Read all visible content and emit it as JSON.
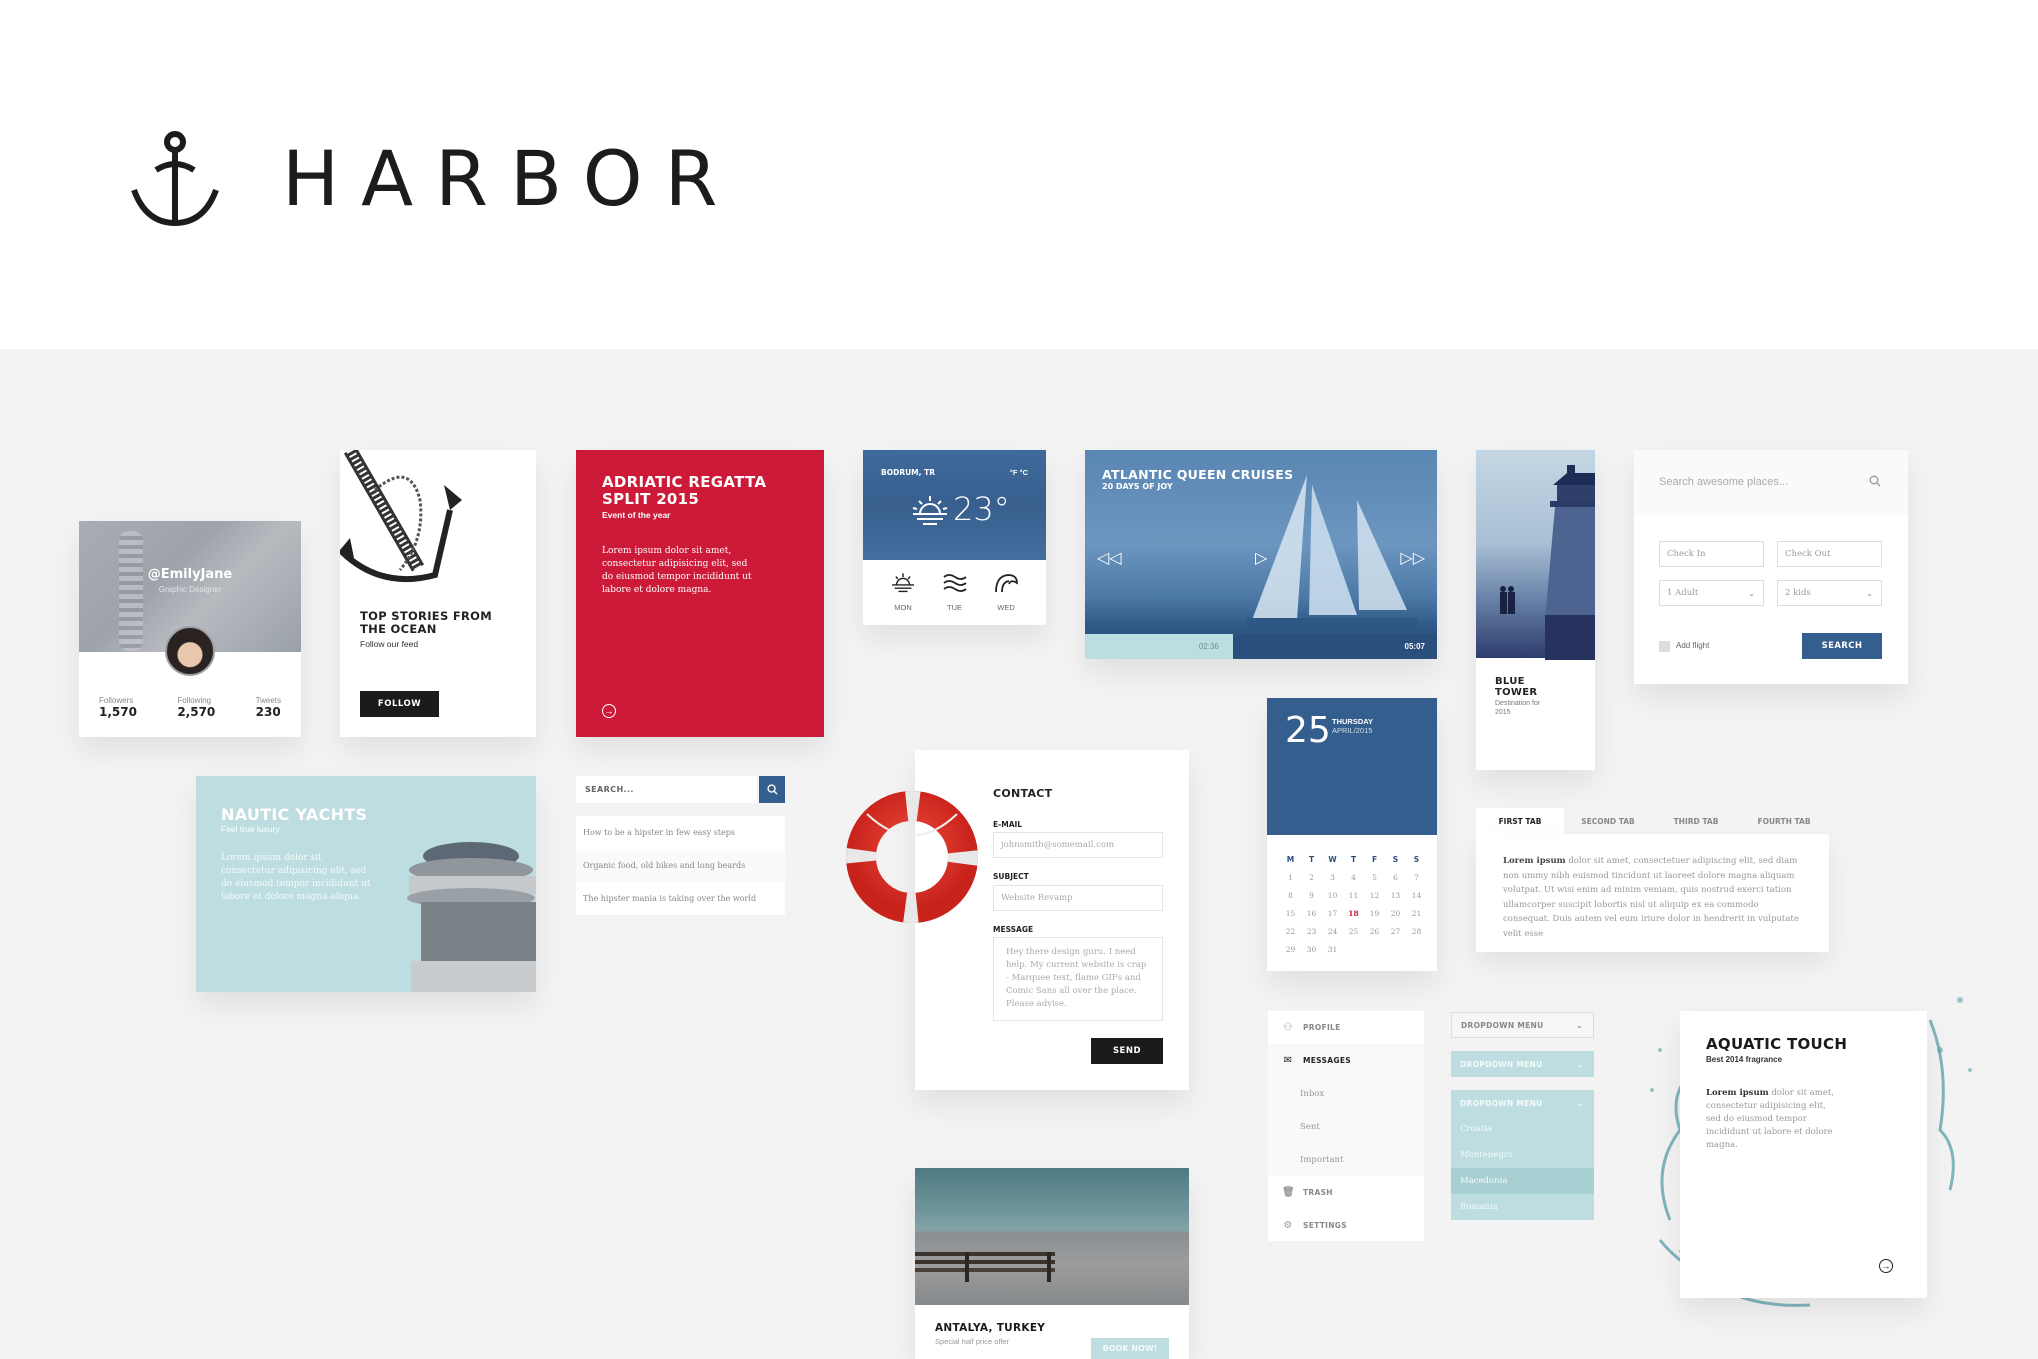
{
  "brand": {
    "name": "HARBOR",
    "logo_icon": "anchor-icon"
  },
  "colors": {
    "accent_blue": "#335e8d",
    "accent_red": "#cc1a38",
    "accent_teal": "#bddde0",
    "background": "#f3f3f3"
  },
  "profile_card": {
    "handle": "@EmilyJane",
    "role": "Graphic Designer",
    "stats": [
      {
        "label": "Followers",
        "value": "1,570"
      },
      {
        "label": "Following",
        "value": "2,570"
      },
      {
        "label": "Tweets",
        "value": "230"
      }
    ]
  },
  "stories_card": {
    "title": "TOP STORIES FROM THE OCEAN",
    "subtitle": "Follow our feed",
    "button": "FOLLOW"
  },
  "regatta_card": {
    "title": "ADRIATIC REGATTA SPLIT 2015",
    "subtitle": "Event of the year",
    "body": "Lorem ipsum dolor sit amet, consectetur adipisicing elit, sed do eiusmod tempor incididunt ut labore et dolore magna.",
    "arrow_icon": "arrow-right-circle-icon"
  },
  "weather_card": {
    "location": "BODRUM, TR",
    "units": "°F °C",
    "temperature": "23°",
    "current_icon": "sunrise-icon",
    "forecast": [
      {
        "day": "MON",
        "icon": "sunrise-icon"
      },
      {
        "day": "TUE",
        "icon": "waves-icon"
      },
      {
        "day": "WED",
        "icon": "big-wave-icon"
      }
    ]
  },
  "video_card": {
    "title": "ATLANTIC QUEEN CRUISES",
    "subtitle": "20 DAYS OF JOY",
    "current_time": "02:36",
    "duration": "05:07",
    "progress": 0.42,
    "controls": {
      "rewind": "⏪",
      "play": "▷",
      "forward": "⏩"
    }
  },
  "tower_card": {
    "title": "BLUE TOWER",
    "subtitle": "Destination for 2015"
  },
  "places_search": {
    "placeholder": "Search awesome places...",
    "check_in": "Check In",
    "check_out": "Check Out",
    "adults": "1 Adult",
    "kids": "2 kids",
    "add_flight_label": "Add flight",
    "add_flight_checked": false,
    "search_button": "SEARCH"
  },
  "nautic_card": {
    "title": "NAUTIC YACHTS",
    "subtitle": "Feel true luxury",
    "body": "Lorem ipsum dolor sit consectetur adipisicing elit, sed do eiusmod tempor incididunt ut labore et dolore magna aliqua."
  },
  "search_list": {
    "placeholder": "SEARCH...",
    "results": [
      "How to be a hipster in few easy steps",
      "Organic food, old bikes and long beards",
      "The hipster mania is taking over the world"
    ]
  },
  "contact_form": {
    "title": "CONTACT",
    "email_label": "E-MAIL",
    "email_placeholder": "johnsmith@somemail.com",
    "subject_label": "SUBJECT",
    "subject_placeholder": "Website Revamp",
    "message_label": "MESSAGE",
    "message_placeholder": "Hey there design guru. I need help. My current website is crap - Marquee text, flame GIFs and Comic Sans all over the place. Please advise.",
    "send_button": "SEND"
  },
  "calendar": {
    "day": "25",
    "weekday": "THURSDAY",
    "month_year": "APRIL/2015",
    "headers": [
      "M",
      "T",
      "W",
      "T",
      "F",
      "S",
      "S"
    ],
    "weeks": [
      [
        "1",
        "2",
        "3",
        "4",
        "5",
        "6",
        "7"
      ],
      [
        "8",
        "9",
        "10",
        "11",
        "12",
        "13",
        "14"
      ],
      [
        "15",
        "16",
        "17",
        "18",
        "19",
        "20",
        "21"
      ],
      [
        "22",
        "23",
        "24",
        "25",
        "26",
        "27",
        "28"
      ],
      [
        "29",
        "30",
        "31",
        "",
        "",
        "",
        ""
      ]
    ],
    "highlighted": "18"
  },
  "tabs_widget": {
    "tabs": [
      "FIRST TAB",
      "SECOND TAB",
      "THIRD TAB",
      "FOURTH TAB"
    ],
    "active_index": 0,
    "content_bold": "Lorem ipsum",
    "content": " dolor sit amet, consectetuer adipiscing elit, sed diam non ummy nibh euismod tincidunt ut laoreet dolore magna aliquam volutpat. Ut wisi enim ad minim veniam, quis nostrud exerci tation ullamcorper suscipit lobortis nisl ut aliquip ex ea commodo consequat. Duis autem vel eum iriure dolor in hendrerit in vulputate velit esse"
  },
  "side_nav": {
    "items": [
      {
        "label": "PROFILE",
        "icon": "user-icon"
      },
      {
        "label": "MESSAGES",
        "icon": "envelope-icon",
        "active": true,
        "children": [
          "Inbox",
          "Sent",
          "Important"
        ]
      },
      {
        "label": "TRASH",
        "icon": "trash-icon"
      },
      {
        "label": "SETTINGS",
        "icon": "gear-icon"
      }
    ]
  },
  "dropdowns": {
    "label": "DROPDOWN MENU",
    "options": [
      "Croatia",
      "Montenegro",
      "Macedonia",
      "Romania"
    ],
    "selected": "Macedonia"
  },
  "aquatic_card": {
    "title": "AQUATIC TOUCH",
    "subtitle": "Best 2014 fragrance",
    "body_bold": "Lorem ipsum",
    "body": " dolor sit amet, consectetur adipisicing elit, sed do eiusmod tempor incididunt ut labore et dolore magna."
  },
  "antalya_card": {
    "title": "ANTALYA, TURKEY",
    "subtitle": "Special half price offer",
    "button": "BOOK NOW!"
  }
}
